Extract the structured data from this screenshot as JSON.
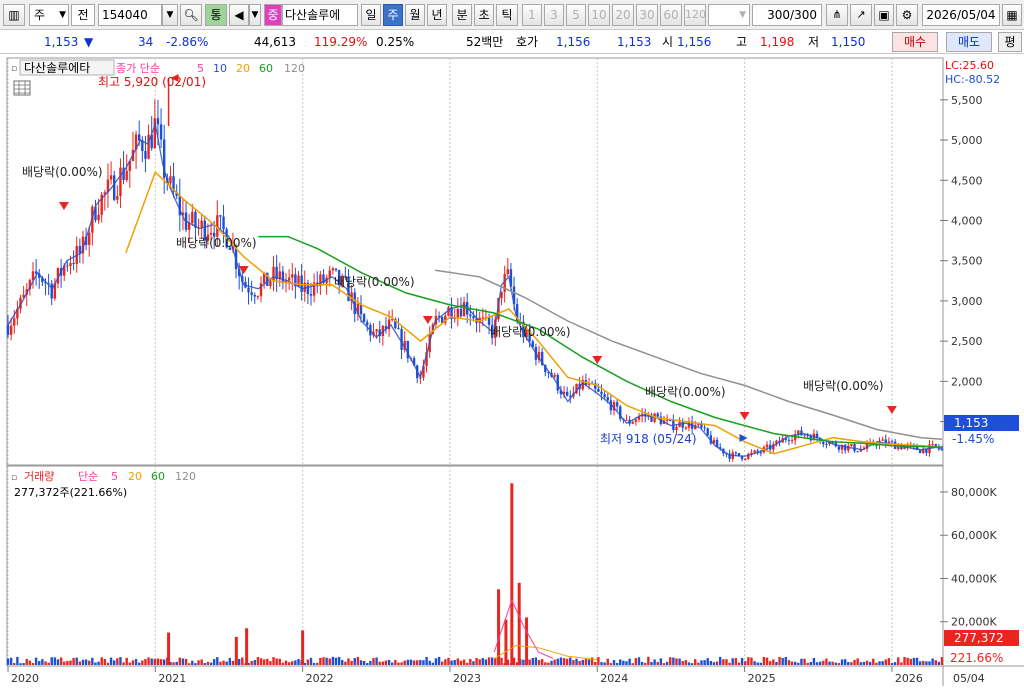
{
  "toolbar": {
    "market_label": "주",
    "prev_label": "전",
    "code": "154040",
    "watch_label": "통",
    "name_badge": "중",
    "stock_name": "다산솔루에",
    "periods": [
      "일",
      "주",
      "월",
      "년",
      "분",
      "초",
      "틱"
    ],
    "active_period": "주",
    "intervals": [
      "1",
      "3",
      "5",
      "10",
      "20",
      "30",
      "60",
      "120"
    ],
    "count": "300",
    "count_total": "/300",
    "date": "2026/05/04"
  },
  "quote": {
    "price": "1,153",
    "change_arrow": "▼",
    "change": "34",
    "change_pct": "-2.86%",
    "volume": "44,613",
    "volume_ratio": "119.29%",
    "turnover": "0.25%",
    "low52_label": "52백만",
    "ask_label": "호가",
    "ask1": "1,156",
    "ask2": "1,153",
    "open_label": "시",
    "open": "1,156",
    "high_label": "고",
    "high": "1,198",
    "low_label": "저",
    "low": "1,150",
    "buy_label": "매수",
    "sell_label": "매도",
    "eval_label": "평"
  },
  "colors": {
    "up": "#e8261f",
    "down": "#1d4fd8",
    "ma5": "#ff3b9a",
    "ma10": "#2a50c8",
    "ma20": "#f0a000",
    "ma60": "#18a020",
    "ma120": "#909090"
  },
  "chart_data": [
    {
      "type": "line",
      "title": "다산솔루에타",
      "legend": {
        "label": "종가 단순",
        "periods": [
          "5",
          "10",
          "20",
          "60",
          "120"
        ]
      },
      "y_ticks": [
        "5,500",
        "5,000",
        "4,500",
        "4,000",
        "3,500",
        "3,000",
        "2,500",
        "2,000",
        "1,500"
      ],
      "ylim": [
        960,
        6020
      ],
      "x_ticks": [
        "2020",
        "2021",
        "2022",
        "2023",
        "2024",
        "2025",
        "2026"
      ],
      "x_tick_end": "05/04",
      "xlim": [
        2020.0,
        2026.34
      ],
      "lc_label": "LC:25.60",
      "hc_label": "HC:-80.52",
      "current_price_label": "1,153",
      "current_change_label": "-1.45%",
      "annotations": {
        "max_label": "최고 5,920 (02/01)",
        "min_label": "최저 918 (05/24)",
        "dividend_labels": [
          "배당락(0.00%)",
          "배당락(0.00%)",
          "배당락(0.00%)",
          "배당락(0.00%)",
          "배당락(0.00%)",
          "배당락(0.00%)"
        ]
      },
      "series": [
        {
          "name": "종가",
          "x": [
            2020.0,
            2020.1,
            2020.2,
            2020.3,
            2020.4,
            2020.5,
            2020.6,
            2020.7,
            2020.8,
            2020.9,
            2020.95,
            2021.0,
            2021.05,
            2021.09,
            2021.15,
            2021.2,
            2021.3,
            2021.4,
            2021.5,
            2021.6,
            2021.7,
            2021.8,
            2021.9,
            2022.0,
            2022.1,
            2022.2,
            2022.3,
            2022.4,
            2022.5,
            2022.6,
            2022.7,
            2022.8,
            2022.9,
            2023.0,
            2023.1,
            2023.2,
            2023.3,
            2023.35,
            2023.4,
            2023.45,
            2023.5,
            2023.6,
            2023.7,
            2023.8,
            2023.9,
            2024.0,
            2024.1,
            2024.2,
            2024.3,
            2024.4,
            2024.5,
            2024.6,
            2024.7,
            2024.8,
            2024.9,
            2025.0,
            2025.1,
            2025.2,
            2025.3,
            2025.4,
            2025.5,
            2025.6,
            2025.7,
            2025.8,
            2025.9,
            2026.0,
            2026.1,
            2026.2,
            2026.3,
            2026.34
          ],
          "values": [
            2700,
            3000,
            3350,
            3150,
            3500,
            3600,
            4200,
            4400,
            4650,
            5000,
            4950,
            5200,
            4700,
            4450,
            4200,
            4000,
            3900,
            3950,
            3800,
            3200,
            3150,
            3300,
            3250,
            3150,
            3200,
            3300,
            3150,
            2750,
            2550,
            2700,
            2400,
            2050,
            2750,
            2900,
            2950,
            2750,
            2600,
            3200,
            3300,
            2800,
            2600,
            2300,
            2050,
            1750,
            1980,
            1850,
            1700,
            1480,
            1580,
            1550,
            1450,
            1480,
            1420,
            1200,
            1080,
            1070,
            1120,
            1200,
            1320,
            1350,
            1300,
            1220,
            1180,
            1150,
            1250,
            1220,
            1180,
            1150,
            1180,
            1153
          ]
        },
        {
          "name": "20",
          "x": [
            2020.8,
            2021.0,
            2021.2,
            2021.4,
            2021.6,
            2021.8,
            2022.0,
            2022.2,
            2022.4,
            2022.6,
            2022.8,
            2023.0,
            2023.2,
            2023.4,
            2023.6,
            2023.8,
            2024.0,
            2024.2,
            2024.4,
            2024.6,
            2024.8,
            2025.0,
            2025.2,
            2025.4,
            2025.6,
            2025.8,
            2026.0,
            2026.2,
            2026.34
          ],
          "values": [
            3600,
            4600,
            4250,
            3950,
            3550,
            3250,
            3200,
            3200,
            2950,
            2800,
            2500,
            2800,
            2750,
            2900,
            2500,
            2050,
            1950,
            1700,
            1550,
            1500,
            1450,
            1250,
            1100,
            1200,
            1300,
            1250,
            1220,
            1200,
            1180
          ]
        },
        {
          "name": "60",
          "x": [
            2021.7,
            2021.9,
            2022.1,
            2022.4,
            2022.7,
            2023.0,
            2023.3,
            2023.6,
            2023.9,
            2024.2,
            2024.5,
            2024.8,
            2025.0,
            2025.2,
            2025.4,
            2025.6,
            2025.8,
            2026.0,
            2026.2,
            2026.34
          ],
          "values": [
            3800,
            3800,
            3650,
            3350,
            3100,
            2950,
            2850,
            2650,
            2300,
            2000,
            1750,
            1550,
            1450,
            1350,
            1300,
            1250,
            1230,
            1200,
            1190,
            1180
          ]
        },
        {
          "name": "120",
          "x": [
            2022.9,
            2023.2,
            2023.5,
            2023.8,
            2024.1,
            2024.4,
            2024.7,
            2025.0,
            2025.3,
            2025.6,
            2025.9,
            2026.2,
            2026.34
          ],
          "values": [
            3380,
            3300,
            3050,
            2750,
            2500,
            2300,
            2100,
            1950,
            1750,
            1580,
            1400,
            1300,
            1280
          ]
        }
      ]
    },
    {
      "type": "bar",
      "title": "거래량",
      "legend": {
        "label": "단순",
        "periods": [
          "5",
          "20",
          "60",
          "120"
        ]
      },
      "value_label": "277,372주(221.66%)",
      "y_ticks": [
        "80,000K",
        "60,000K",
        "40,000K",
        "20,000K"
      ],
      "ylim": [
        0,
        92000
      ],
      "current_volume_label": "277,372",
      "current_ratio_label": "221.66%",
      "spikes": {
        "x": [
          2021.09,
          2021.55,
          2021.62,
          2022.0,
          2023.33,
          2023.38,
          2023.42,
          2023.47,
          2023.52
        ],
        "values": [
          15000,
          13000,
          17000,
          16000,
          35000,
          21000,
          84000,
          38000,
          22000
        ]
      }
    }
  ]
}
